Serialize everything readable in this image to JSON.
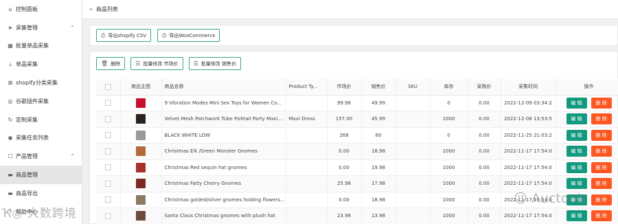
{
  "sidebar": {
    "items": [
      {
        "label": "控制面板",
        "icon": "home-icon",
        "glyph": "⌂",
        "chev": ""
      },
      {
        "label": "采集管理",
        "icon": "send-icon",
        "glyph": "➤",
        "chev": "⌃"
      },
      {
        "label": "批量单品采集",
        "icon": "grid-icon",
        "glyph": "▦",
        "chev": ""
      },
      {
        "label": "单品采集",
        "icon": "download-icon",
        "glyph": "⤓",
        "chev": ""
      },
      {
        "label": "shopify分类采集",
        "icon": "puzzle-icon",
        "glyph": "⊠",
        "chev": ""
      },
      {
        "label": "谷歌插件采集",
        "icon": "chrome-icon",
        "glyph": "◎",
        "chev": ""
      },
      {
        "label": "定制采集",
        "icon": "custom-icon",
        "glyph": "↻",
        "chev": ""
      },
      {
        "label": "采集任务列表",
        "icon": "task-icon",
        "glyph": "◉",
        "chev": ""
      },
      {
        "label": "产品管理",
        "icon": "product-icon",
        "glyph": "☐",
        "chev": "⌃"
      },
      {
        "label": "商品管理",
        "icon": "box-icon",
        "glyph": "▬",
        "chev": ""
      },
      {
        "label": "商品导出",
        "icon": "export-icon",
        "glyph": "▬",
        "chev": ""
      },
      {
        "label": "帮助中心",
        "icon": "help-icon",
        "glyph": "?",
        "chev": ""
      }
    ]
  },
  "breadcrumb": {
    "sep": "»",
    "title": "商品列表"
  },
  "export": {
    "csv_label": "导出shopify CSV",
    "woo_label": "导出WooCommerce"
  },
  "actions": {
    "delete_label": "删除",
    "batch_market_label": "批量修改 市场价",
    "batch_sale_label": "批量修改 销售价"
  },
  "table": {
    "headers": [
      "商品主图",
      "商品名称",
      "Product Ty...",
      "市场价",
      "销售价",
      "SKU",
      "库存",
      "采购价",
      "采集时间",
      "操作"
    ],
    "edit_label": "编 辑",
    "delete_label": "删 除",
    "rows": [
      {
        "name": "9 Vibration Modes Mini Sex Toys for Women Co...",
        "type": "",
        "market": "99.98",
        "sale": "49.99",
        "sku": "",
        "stock": "0",
        "cost": "0.00",
        "time": "2022-12-09 03:34:2",
        "thumb": "#c8102e"
      },
      {
        "name": "Velvet Mesh Patchwork Tube Fishtail Party Maxi...",
        "type": "Maxi Dress",
        "market": "157.00",
        "sale": "45.99",
        "sku": "",
        "stock": "1000",
        "cost": "0.00",
        "time": "2022-12-08 13:53:5",
        "thumb": "#2a2320"
      },
      {
        "name": "BLACK WHITE LOW",
        "type": "",
        "market": "268",
        "sale": "80",
        "sku": "",
        "stock": "0",
        "cost": "0.00",
        "time": "2022-11-25 21:03:2",
        "thumb": "#9a9a9a"
      },
      {
        "name": "Christmas Elk /Green Monster Gnomes",
        "type": "",
        "market": "0.00",
        "sale": "18.98",
        "sku": "",
        "stock": "1000",
        "cost": "0.00",
        "time": "2022-11-17 17:54:0",
        "thumb": "#b5693a"
      },
      {
        "name": "Christmas Red sequin hat gnomes",
        "type": "",
        "market": "0.00",
        "sale": "19.98",
        "sku": "",
        "stock": "1000",
        "cost": "0.00",
        "time": "2022-11-17 17:54:0",
        "thumb": "#a8322b"
      },
      {
        "name": "Christmas Fatty Cherry Gnomes",
        "type": "",
        "market": "25.98",
        "sale": "17.98",
        "sku": "",
        "stock": "1000",
        "cost": "0.00",
        "time": "2022-11-17 17:54:0",
        "thumb": "#7a2a22"
      },
      {
        "name": "Christmas golded/silver gnomes holding flowers ...",
        "type": "",
        "market": "0.00",
        "sale": "18.98",
        "sku": "",
        "stock": "1000",
        "cost": "0.00",
        "time": "2022-11-17 17:54:0",
        "thumb": "#8c7a62"
      },
      {
        "name": "Santa Claus Christmas gnomes with plush hat",
        "type": "",
        "market": "23.98",
        "sale": "13.98",
        "sku": "",
        "stock": "1000",
        "cost": "0.00",
        "time": "2022-11-17 17:54:0",
        "thumb": "#6e4b3a"
      }
    ]
  },
  "watermark": {
    "left": "大数跨境",
    "right": "Auctools"
  },
  "colors": {
    "edit": "#12997f",
    "delete": "#ff5722",
    "border": "#3aa58e"
  }
}
